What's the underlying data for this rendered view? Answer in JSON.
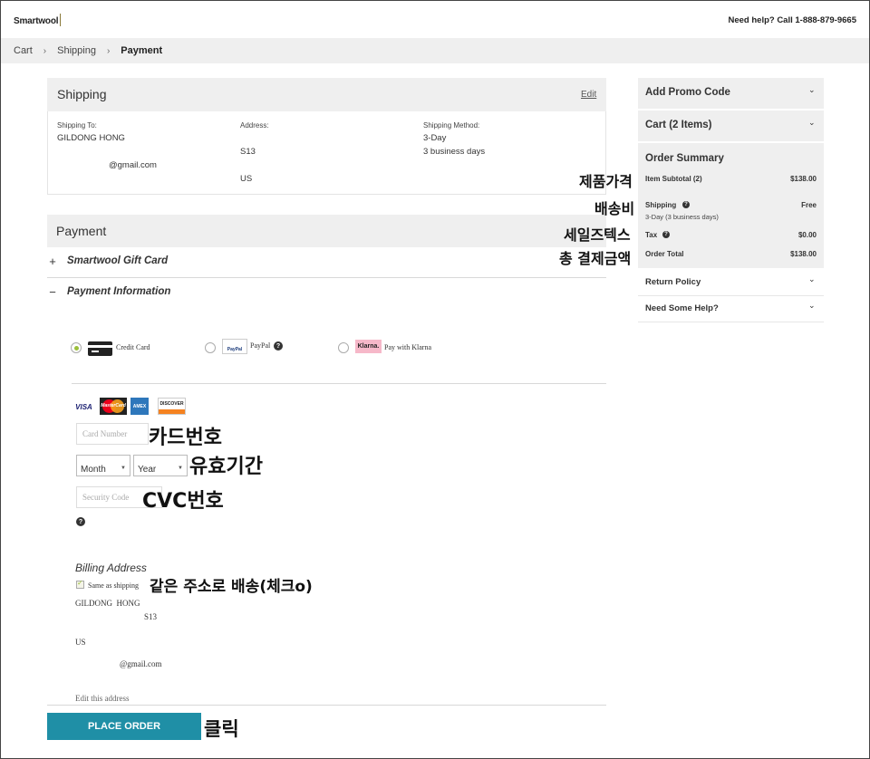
{
  "header": {
    "logo": "Smartwool",
    "help": "Need help? Call 1-888-879-9665"
  },
  "breadcrumb": {
    "cart": "Cart",
    "shipping": "Shipping",
    "payment": "Payment",
    "sep": "›"
  },
  "shipping": {
    "title": "Shipping",
    "edit": "Edit",
    "to_label": "Shipping To:",
    "name": "GILDONG HONG",
    "email": "@gmail.com",
    "address_label": "Address:",
    "address_line1": "S13",
    "address_country": "US",
    "method_label": "Shipping Method:",
    "method": "3-Day",
    "method_time": "3 business days"
  },
  "payment": {
    "title": "Payment",
    "gift_sign": "+",
    "gift_card": "Smartwool Gift Card",
    "info_sign": "−",
    "info": "Payment Information",
    "methods": {
      "credit_card": "Credit Card",
      "paypal": "PayPal",
      "paypal_logo": "PayPal",
      "klarna": "Pay with Klarna",
      "klarna_logo": "Klarna."
    },
    "card_brands": {
      "visa": "VISA",
      "mastercard": "MasterCard",
      "amex": "AMEX",
      "discover": "DISCOVER"
    },
    "card_number_placeholder": "Card Number",
    "month": "Month",
    "year": "Year",
    "security_placeholder": "Security Code",
    "qmark": "?",
    "billing_title": "Billing Address",
    "same_as_shipping": "Same as shipping",
    "billing_name": "GILDONG  HONG",
    "billing_line1": "S13",
    "billing_country": "US",
    "billing_email": "@gmail.com",
    "edit_address": "Edit this address",
    "place_order": "PLACE ORDER"
  },
  "sidebar": {
    "promo": "Add Promo Code",
    "cart": "Cart (2 Items)",
    "summary_title": "Order Summary",
    "item_subtotal_label": "Item Subtotal (2)",
    "item_subtotal": "$138.00",
    "shipping_label": "Shipping",
    "shipping_value": "Free",
    "shipping_sub": "3-Day (3 business days)",
    "tax_label": "Tax",
    "tax_value": "$0.00",
    "total_label": "Order Total",
    "total_value": "$138.00",
    "return_policy": "Return Policy",
    "need_help": "Need Some Help?",
    "chevron": "⌄"
  },
  "annotations": {
    "product_price": "제품가격",
    "shipping_fee": "배송비",
    "sales_tax": "세일즈텍스",
    "total_payment": "총 결제금액",
    "card_number": "카드번호",
    "expiry": "유효기간",
    "cvc": "CVC번호",
    "same_address": "같은 주소로 배송(체크o)",
    "click": "클릭"
  }
}
